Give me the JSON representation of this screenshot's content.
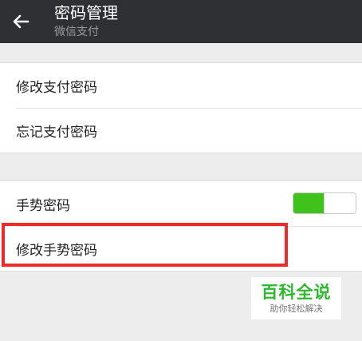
{
  "header": {
    "title": "密码管理",
    "subtitle": "微信支付",
    "back_icon": "back-arrow-icon"
  },
  "groups": {
    "payment": {
      "items": [
        {
          "label": "修改支付密码"
        },
        {
          "label": "忘记支付密码"
        }
      ]
    },
    "gesture": {
      "items": [
        {
          "label": "手势密码",
          "toggle_on": true
        },
        {
          "label": "修改手势密码"
        }
      ]
    }
  },
  "highlight_color": "#ee2b2b",
  "toggle_color": "#3fc31a",
  "watermark": {
    "title": "百科全说",
    "subtitle": "助你轻松解决"
  }
}
